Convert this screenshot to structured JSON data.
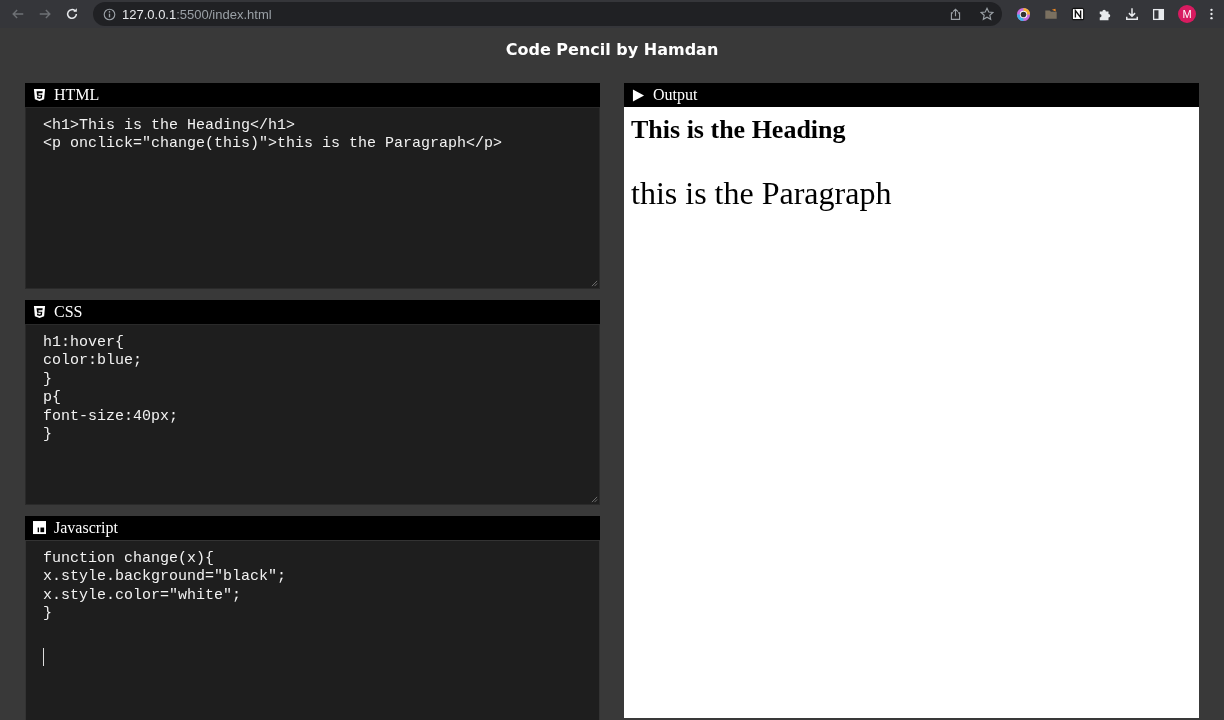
{
  "browser": {
    "address": "**127.0.0.1**:5500/index.html",
    "profile_initial": "M"
  },
  "app_title": "Code Pencil by Hamdan",
  "editors": [
    {
      "kind": "html",
      "label": "HTML",
      "focused": false,
      "lines": [
        "<h1>This is the Heading</h1>",
        "<p onclick=\"change(this)\">this is the Paragraph</p>"
      ]
    },
    {
      "kind": "css",
      "label": "CSS",
      "focused": false,
      "lines": [
        "h1:hover{",
        "color:blue;",
        "}",
        "p{",
        "font-size:40px;",
        "}"
      ]
    },
    {
      "kind": "js",
      "label": "Javascript",
      "focused": true,
      "lines": [
        "function change(x){",
        "x.style.background=\"black\";",
        "x.style.color=\"white\";",
        "}"
      ]
    }
  ],
  "output": {
    "label": "Output",
    "heading": "This is the Heading",
    "paragraph": "this is the Paragraph"
  }
}
